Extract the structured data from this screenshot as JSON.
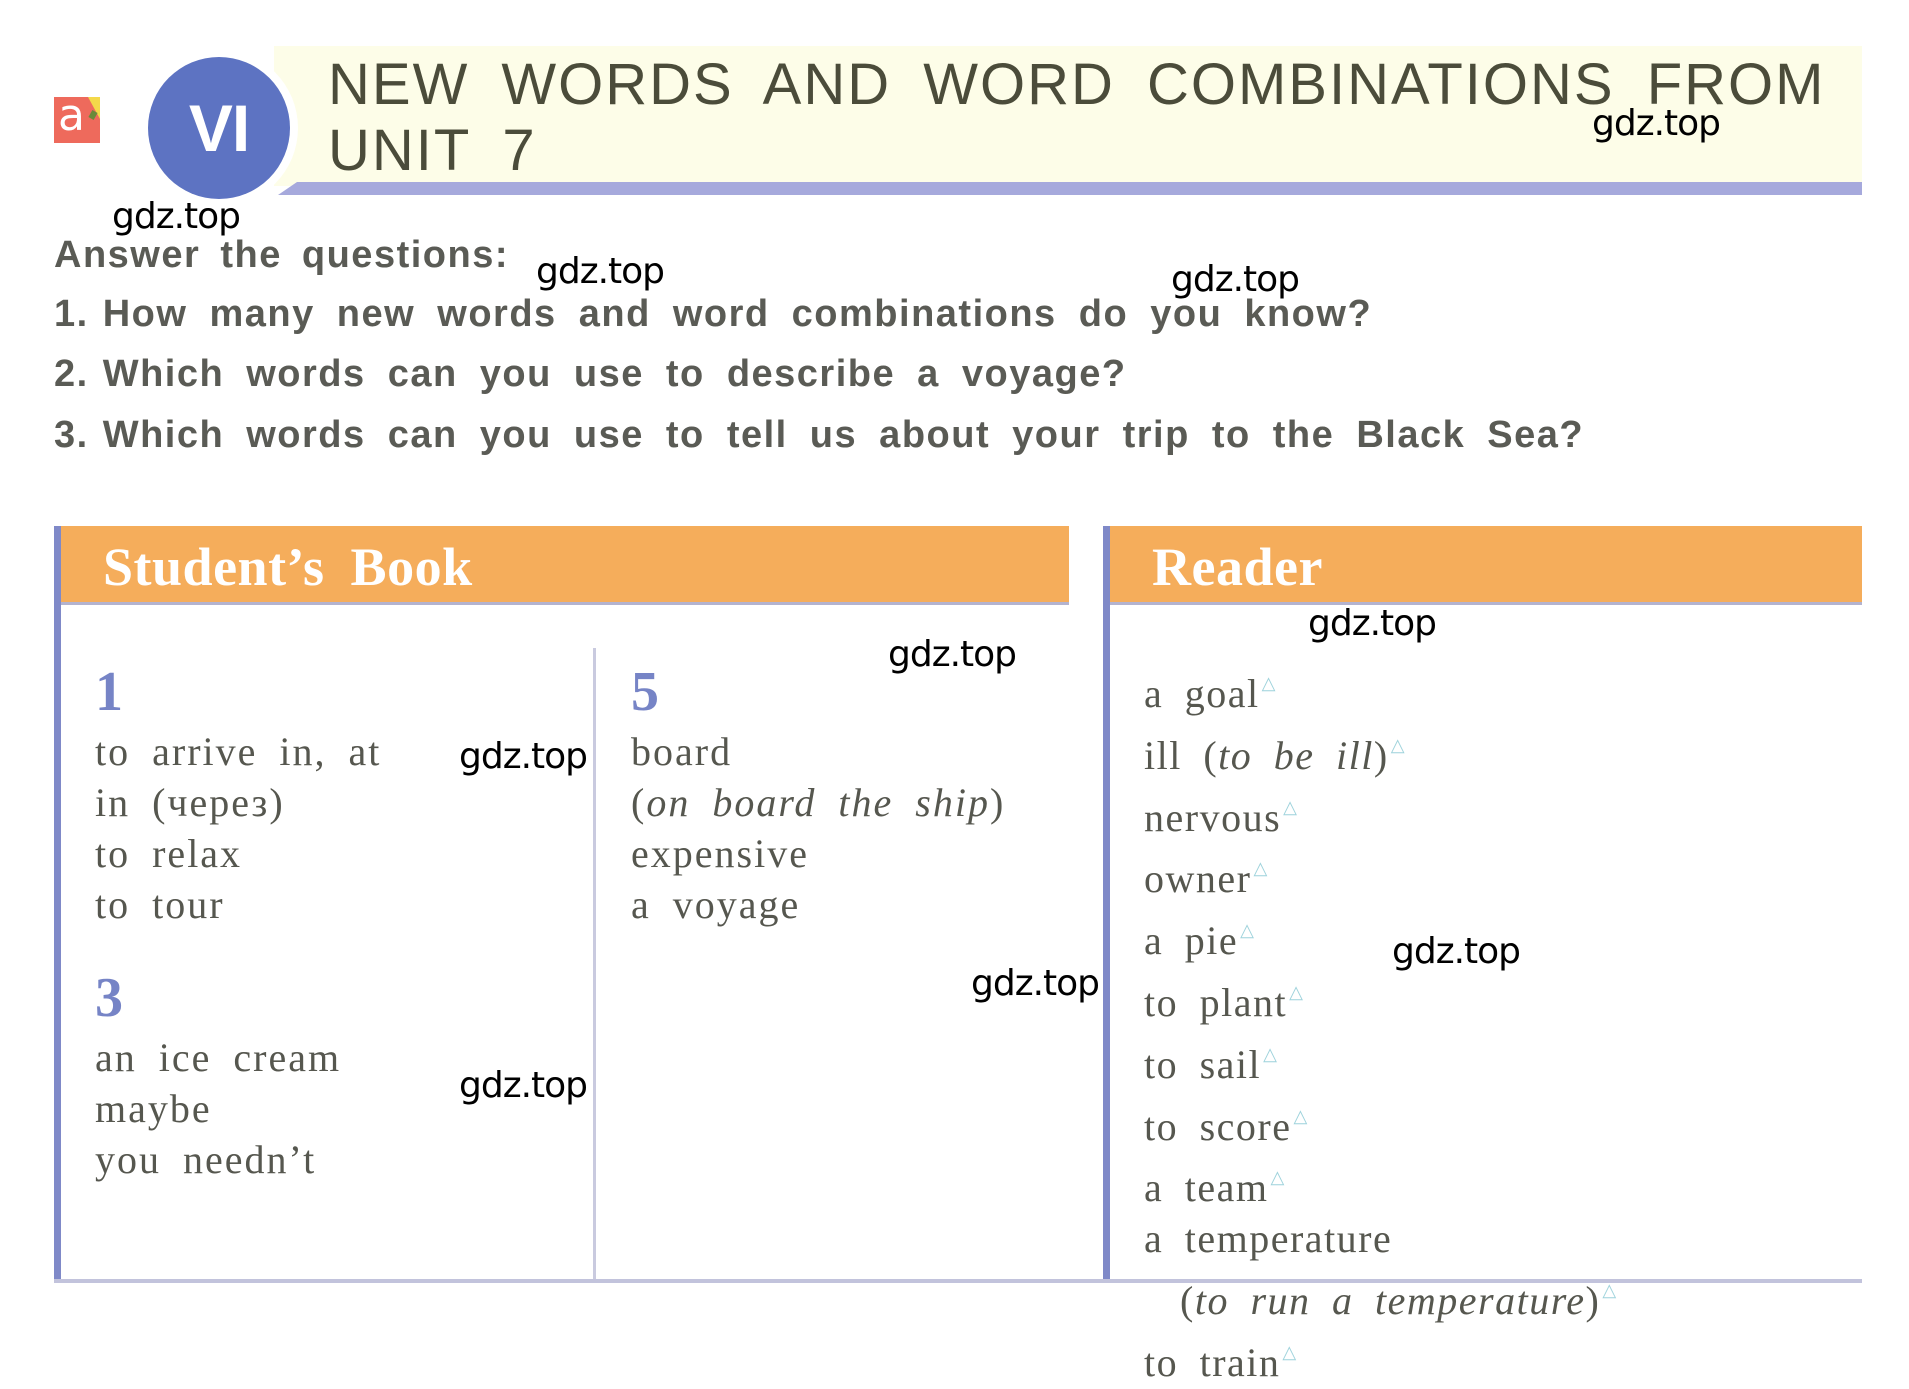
{
  "header": {
    "logo_letter": "a",
    "unit_badge": "VI",
    "title_line1": "NEW WORDS AND WORD COMBINATIONS FROM",
    "title_line2": "UNIT 7"
  },
  "questions": {
    "intro": "Answer the questions:",
    "items": [
      {
        "num": "1.",
        "text": "How many new words and word combinations do you know?"
      },
      {
        "num": "2.",
        "text": "Which words can you use to describe a voyage?"
      },
      {
        "num": "3.",
        "text": "Which words can you use to tell us about your trip to the Black Sea?"
      }
    ]
  },
  "students_book": {
    "title": "Student’s Book",
    "sections": [
      {
        "num": "1",
        "words": [
          "to arrive in, at",
          "in (через)",
          "to relax",
          "to tour"
        ]
      },
      {
        "num": "3",
        "words": [
          "an ice cream",
          "maybe",
          "you needn’t"
        ]
      },
      {
        "num": "5",
        "words": [
          "board",
          "(on board the ship)",
          "expensive",
          "a voyage"
        ]
      }
    ]
  },
  "reader": {
    "title": "Reader",
    "marker_icon": "triangle-outline",
    "words": [
      {
        "main": "a goal",
        "italic": "",
        "marked": true
      },
      {
        "main": "ill ",
        "italic": "(to be ill)",
        "marked": true
      },
      {
        "main": "nervous",
        "italic": "",
        "marked": true
      },
      {
        "main": "owner",
        "italic": "",
        "marked": true
      },
      {
        "main": "a pie",
        "italic": "",
        "marked": true
      },
      {
        "main": "to plant",
        "italic": "",
        "marked": true
      },
      {
        "main": "to sail",
        "italic": "",
        "marked": true
      },
      {
        "main": "to score",
        "italic": "",
        "marked": true
      },
      {
        "main": "a team",
        "italic": "",
        "marked": true
      },
      {
        "main": "a temperature",
        "italic": "",
        "marked": false
      },
      {
        "main": "",
        "italic": "(to run a temperature)",
        "marked": true
      },
      {
        "main": "to train",
        "italic": "",
        "marked": true
      }
    ]
  },
  "watermark": "gdz.top",
  "colors": {
    "badge_blue": "#5d73c2",
    "header_orange": "#f5ad5b",
    "panel_border": "#7f89c8",
    "section_number": "#7684c6",
    "banner_bg": "#fdfde8",
    "marker_cyan": "#9fd3dc"
  }
}
